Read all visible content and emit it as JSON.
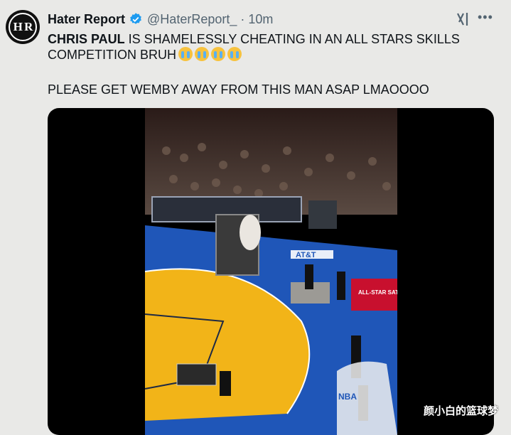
{
  "author": {
    "display_name": "Hater Report",
    "handle": "@HaterReport_",
    "time": "10m",
    "avatar_text": "H R"
  },
  "tweet": {
    "bold_lead": "CHRIS PAUL",
    "text_line1": " IS SHAMELESSLY CHEATING IN AN ALL STARS SKILLS COMPETITION BRUH",
    "text_line3": "PLEASE GET WEMBY AWAY FROM THIS MAN ASAP LMAOOOO",
    "emoji_count": 4
  },
  "media": {
    "kind": "video",
    "scene": "basketball court skills competition",
    "sponsor_text": "AT&T",
    "banner_text": "ALL-STAR SATURDAY",
    "court_logo": "NBA"
  },
  "watermark": "颜小白的篮球梦",
  "icons": {
    "verified": "verified-badge-icon",
    "grok": "grok-icon",
    "more": "more-options-icon"
  },
  "colors": {
    "verified_blue": "#1d9bf0",
    "muted_text": "#536471",
    "background": "#e9e9e7"
  }
}
